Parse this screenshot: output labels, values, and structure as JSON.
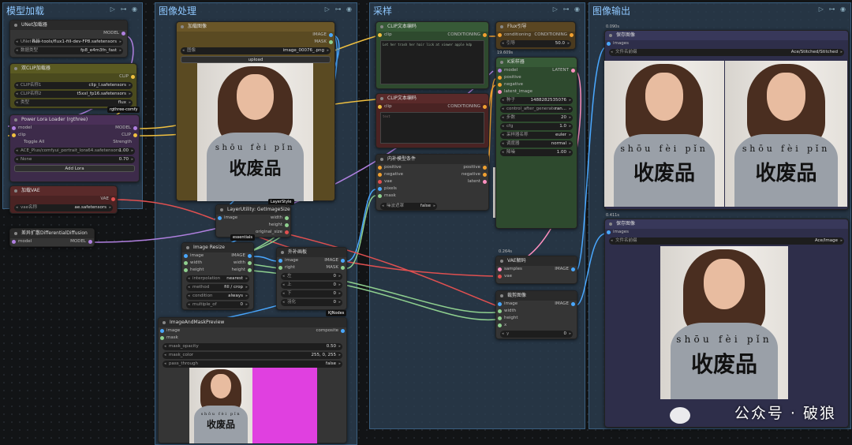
{
  "groups": [
    {
      "title": "模型加载"
    },
    {
      "title": "图像处理"
    },
    {
      "title": "采样"
    },
    {
      "title": "图像输出"
    }
  ],
  "nodes": {
    "unet": {
      "title": "UNet加载器",
      "output": "MODEL",
      "w1k": "UNet名称",
      "w1v": "flux-tools/flux1-fill-dev-FP8.safetensors",
      "w2k": "数据类型",
      "w2v": "fp8_e4m3fn_fast"
    },
    "dualclip": {
      "title": "双CLIP加载器",
      "output": "CLIP",
      "w1k": "CLIP名称1",
      "w1v": "clip_l.safetensors",
      "w2k": "CLIP名称2",
      "w2v": "t5xxl_fp16.safetensors",
      "w3k": "类型",
      "w3v": "flux",
      "badge": "rgthree-comfy"
    },
    "lora": {
      "title": "Power Lora Loader (rgthree)",
      "in1": "model",
      "in2": "clip",
      "out1": "MODEL",
      "out2": "CLIP",
      "toggle": "Toggle All",
      "strength": "Strength",
      "l1": "ACE_Plus/comfyui_portrait_lora64.safetensors",
      "l1v": "1.00",
      "l2": "None",
      "l2v": "0.70",
      "add": "Add Lora"
    },
    "vae": {
      "title": "加载VAE",
      "output": "VAE",
      "wk": "vae名称",
      "wv": "ae.safetensors"
    },
    "diff": {
      "title": "差异扩散DifferentialDiffusion",
      "in": "model",
      "out": "MODEL"
    },
    "loadimg": {
      "title": "加载图像",
      "out1": "IMAGE",
      "out2": "MASK",
      "wk": "图像",
      "wv": "image_00076_.png",
      "upload": "upload",
      "badge": "LayerStyle"
    },
    "getsize": {
      "title": "LayerUtility: GetImageSize",
      "in": "image",
      "o1": "width",
      "o2": "height",
      "o3": "original_size",
      "badge": "essentials"
    },
    "resize": {
      "title": "Image Resize",
      "i1": "image",
      "i2": "width",
      "i3": "height",
      "o1": "IMAGE",
      "o2": "width",
      "o3": "height",
      "w1k": "interpolation",
      "w1v": "nearest",
      "w2k": "method",
      "w2v": "fill / crop",
      "w3k": "condition",
      "w3v": "always",
      "w4k": "multiple_of",
      "w4v": "0"
    },
    "pad": {
      "title": "外补画板",
      "i1": "image",
      "i2": "right",
      "o1": "IMAGE",
      "o2": "MASK",
      "w1k": "左",
      "w1v": "0",
      "w2k": "上",
      "w2v": "0",
      "w3k": "下",
      "w3v": "0",
      "w4k": "羽化",
      "w4v": "0",
      "badge": "KJNodes"
    },
    "maskprev": {
      "title": "ImageAndMaskPreview",
      "i1": "image",
      "i2": "mask",
      "o1": "composite",
      "w1k": "mask_opacity",
      "w1v": "0.50",
      "w2k": "mask_color",
      "w2v": "255, 0, 255",
      "w3k": "pass_through",
      "w3v": "false"
    },
    "clip1": {
      "title": "CLIP文本编码",
      "in": "clip",
      "out": "CONDITIONING",
      "text": "Let her trash her hair lick at viewer apple kdp"
    },
    "clip2": {
      "title": "CLIP文本编码",
      "in": "clip",
      "out": "CONDITIONING",
      "text": "text"
    },
    "inpaint": {
      "title": "内补模型条件",
      "i1": "positive",
      "i2": "negative",
      "i3": "vae",
      "i4": "pixels",
      "i5": "mask",
      "o1": "positive",
      "o2": "negative",
      "o3": "latent",
      "wk": "噪波遮罩",
      "wv": "false"
    },
    "flux": {
      "title": "Flux引导",
      "in": "conditioning",
      "out": "CONDITIONING",
      "wk": "引导",
      "wv": "50.0",
      "time": "19.609s"
    },
    "ksampler": {
      "title": "K采样器",
      "i1": "model",
      "i2": "positive",
      "i3": "negative",
      "i4": "latent_image",
      "out": "LATENT",
      "w1k": "种子",
      "w1v": "1488282535076",
      "w2k": "control_after_generate",
      "w2v": "ran...",
      "w3k": "步数",
      "w3v": "20",
      "w4k": "cfg",
      "w4v": "1.0",
      "w5k": "采样器名称",
      "w5v": "euler",
      "w6k": "调度器",
      "w6v": "normal",
      "w7k": "降噪",
      "w7v": "1.00"
    },
    "vaedecode": {
      "title": "VAE解码",
      "i1": "samples",
      "i2": "vae",
      "out": "IMAGE",
      "time": "0.264s"
    },
    "crop": {
      "title": "裁剪图像",
      "i1": "image",
      "i2": "width",
      "i3": "height",
      "i4": "x",
      "out": "IMAGE",
      "wk": "y",
      "wv": "0"
    },
    "save1": {
      "title": "保存图像",
      "in": "images",
      "wk": "文件名前缀",
      "wv": "Ace/Stitched/Stitched",
      "time": "0.090s"
    },
    "save2": {
      "title": "保存图像",
      "in": "images",
      "wk": "文件名前缀",
      "wv": "Ace/Image",
      "time": "0.411s"
    }
  },
  "shirt": {
    "pinyin": "shōu  fèi  pǐn",
    "hanzi": "收废品"
  },
  "watermark": "公众号 · 破狼",
  "colors": {
    "group": "#2b3f52",
    "clip_node": "#4a4a1e",
    "lora_node": "#3d2b4a",
    "vae_node": "#4a2323",
    "sampler_node": "#2e4a2e",
    "cond_node": "#4a2323",
    "flux_node": "#4a3a1e",
    "save_node": "#2e2e4a"
  }
}
